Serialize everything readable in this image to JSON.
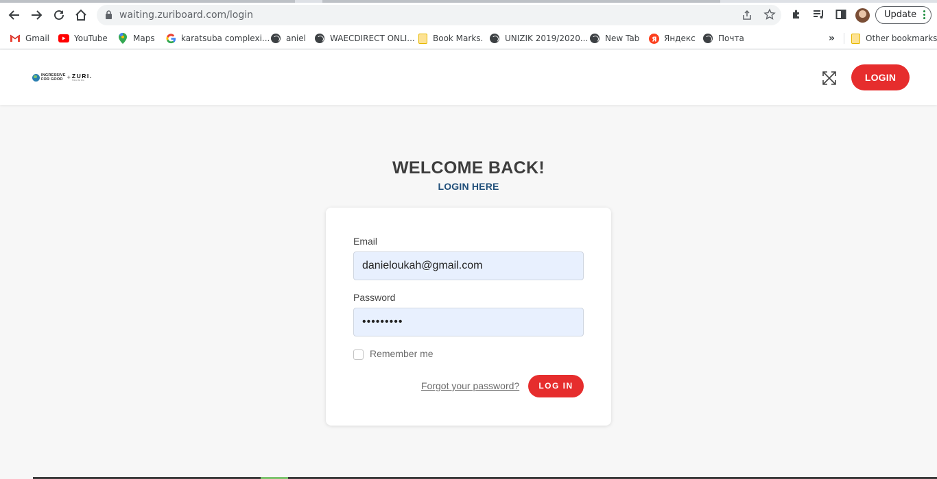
{
  "browser": {
    "url": "waiting.zuriboard.com/login",
    "update_label": "Update",
    "bookmarks": [
      {
        "label": "Gmail",
        "icon": "gmail-icon"
      },
      {
        "label": "YouTube",
        "icon": "youtube-icon"
      },
      {
        "label": "Maps",
        "icon": "maps-icon"
      },
      {
        "label": "karatsuba complexi...",
        "icon": "google-icon"
      },
      {
        "label": "aniel",
        "icon": "globe-icon"
      },
      {
        "label": "WAECDIRECT ONLI...",
        "icon": "globe-icon"
      },
      {
        "label": "Book Marks.",
        "icon": "folder-icon"
      },
      {
        "label": "UNIZIK 2019/2020...",
        "icon": "globe-icon"
      },
      {
        "label": "New Tab",
        "icon": "globe-icon"
      },
      {
        "label": "Яндекс",
        "icon": "yandex-icon"
      },
      {
        "label": "Почта",
        "icon": "globe-icon"
      }
    ],
    "overflow_label": "»",
    "other_bookmarks": "Other bookmarks"
  },
  "header": {
    "logo_text_1": "INGRESSIVE",
    "logo_text_2": "FOR GOOD",
    "logo_plus": "+",
    "logo_zuri": "ZURI.",
    "logo_sub": "TRAINING",
    "login_label": "LOGIN"
  },
  "main": {
    "title": "WELCOME BACK!",
    "subtitle": "LOGIN HERE",
    "form": {
      "email_label": "Email",
      "email_value": "danieloukah@gmail.com",
      "password_label": "Password",
      "password_value": "•••••••••",
      "remember_label": "Remember me",
      "forgot_label": "Forgot your password?",
      "submit_label": "LOG IN"
    }
  },
  "colors": {
    "accent": "#e62d2d",
    "link": "#1f4e79",
    "input_bg": "#e8f0fe"
  }
}
